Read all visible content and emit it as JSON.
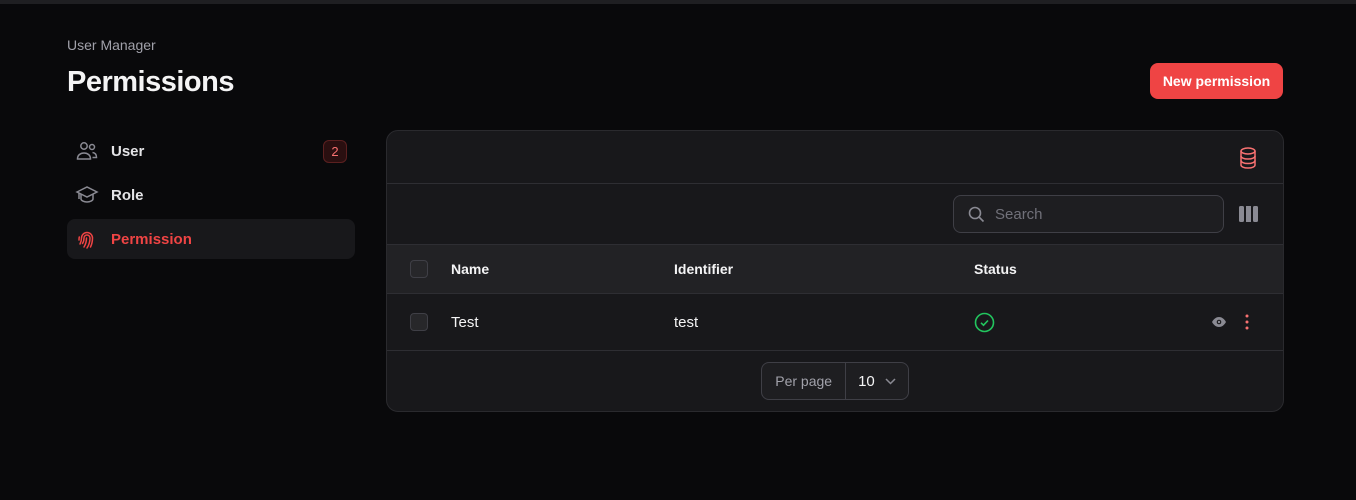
{
  "breadcrumb": "User Manager",
  "title": "Permissions",
  "new_button": "New permission",
  "sidebar": {
    "items": [
      {
        "label": "User",
        "badge": "2"
      },
      {
        "label": "Role"
      },
      {
        "label": "Permission"
      }
    ]
  },
  "table": {
    "search_placeholder": "Search",
    "columns": [
      "Name",
      "Identifier",
      "Status"
    ],
    "rows": [
      {
        "name": "Test",
        "identifier": "test",
        "status": "active"
      }
    ],
    "per_page_label": "Per page",
    "per_page_value": "10"
  },
  "colors": {
    "accent": "#ef4444",
    "success": "#22c55e"
  }
}
